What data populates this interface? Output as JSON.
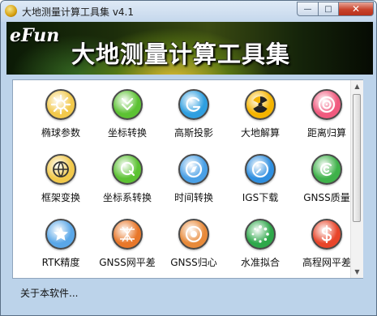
{
  "window": {
    "title": "大地测量计算工具集 v4.1"
  },
  "banner": {
    "brand": "eFun",
    "title": "大地测量计算工具集"
  },
  "tools": [
    {
      "label": "椭球参数",
      "icon": "gear-icon",
      "color": "#f2c94c"
    },
    {
      "label": "坐标转换",
      "icon": "double-chevron-down-icon",
      "color": "#5cc233"
    },
    {
      "label": "高斯投影",
      "icon": "g-logo-icon",
      "color": "#2f9fe0"
    },
    {
      "label": "大地解算",
      "icon": "radiation-icon",
      "color": "#f5b400"
    },
    {
      "label": "距离归算",
      "icon": "target-icon",
      "color": "#f05a7e"
    },
    {
      "label": "框架变换",
      "icon": "globe-icon",
      "color": "#f2c94c"
    },
    {
      "label": "坐标系转换",
      "icon": "q-circle-icon",
      "color": "#5cc233"
    },
    {
      "label": "时间转换",
      "icon": "compass-icon",
      "color": "#4aa0e6"
    },
    {
      "label": "IGS下载",
      "icon": "clock-icon",
      "color": "#2f8fe0"
    },
    {
      "label": "GNSS质量",
      "icon": "cc-logo-icon",
      "color": "#3fb24a"
    },
    {
      "label": "RTK精度",
      "icon": "star-icon",
      "color": "#5aa7e8"
    },
    {
      "label": "GNSS网平差",
      "icon": "network-icon",
      "color": "#e8772a"
    },
    {
      "label": "GNSS归心",
      "icon": "ring-target-icon",
      "color": "#e88a3a"
    },
    {
      "label": "水准拟合",
      "icon": "loading-spinner-icon",
      "color": "#2ea84a"
    },
    {
      "label": "高程网平差",
      "icon": "dollar-icon",
      "color": "#e8452a"
    }
  ],
  "footer": {
    "about_link": "关于本软件..."
  }
}
